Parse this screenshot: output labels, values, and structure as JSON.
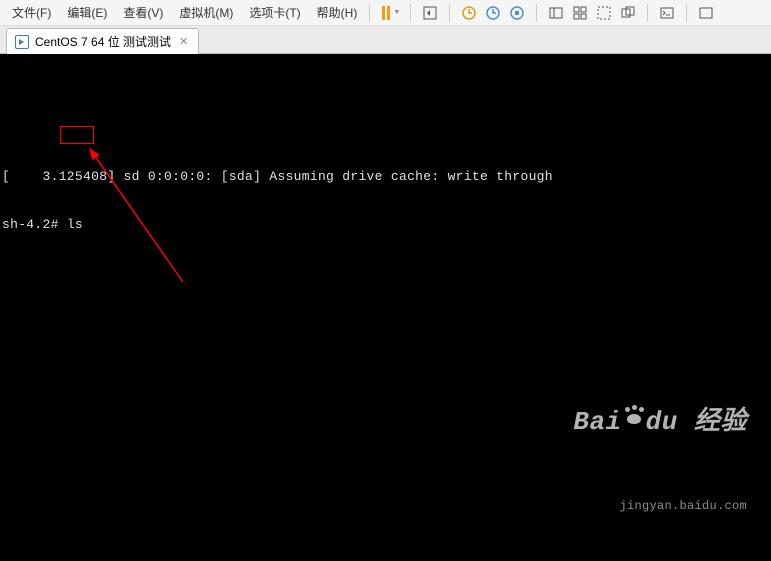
{
  "menubar": {
    "items": [
      {
        "label": "文件(F)"
      },
      {
        "label": "编辑(E)"
      },
      {
        "label": "查看(V)"
      },
      {
        "label": "虚拟机(M)"
      },
      {
        "label": "选项卡(T)"
      },
      {
        "label": "帮助(H)"
      }
    ]
  },
  "tab": {
    "title": "CentOS 7 64 位 测试测试"
  },
  "terminal": {
    "line1": "[    3.125408] sd 0:0:0:0: [sda] Assuming drive cache: write through",
    "prompt": "sh-4.2# ",
    "cmd": "ls"
  },
  "watermark": {
    "brand_a": "Bai",
    "brand_b": "du",
    "brand_c": "经验",
    "sub": "jingyan.baidu.com"
  }
}
